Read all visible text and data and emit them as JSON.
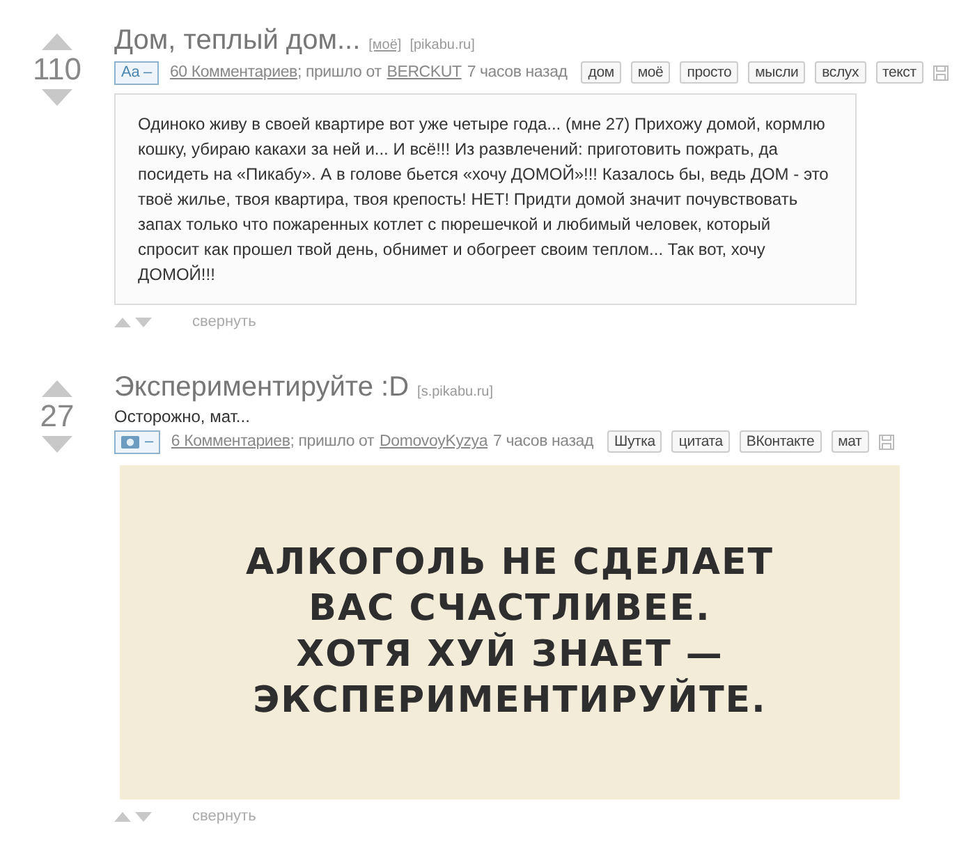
{
  "posts": [
    {
      "kind": "text",
      "score": "110",
      "title": "Дом, теплый дом...",
      "sources": [
        "[моё]",
        "[pikabu.ru]"
      ],
      "badge": {
        "kind": "text",
        "label": "Аа –"
      },
      "comments": "60 Комментариев",
      "via": "; пришло от",
      "author": "BERCKUT",
      "time": "7 часов назад",
      "tags": [
        "дом",
        "моё",
        "просто",
        "мысли",
        "вслух",
        "текст"
      ],
      "body": "Одиноко живу в своей квартире вот уже четыре года... (мне 27) Прихожу домой, кормлю кошку, убираю какахи за ней и... И всё!!! Из развлечений: приготовить пожрать, да посидеть на «Пикабу». А в голове бьется «хочу ДОМОЙ»!!! Казалось бы, ведь ДОМ - это твоё жилье, твоя квартира, твоя крепость! НЕТ! Придти домой значит почувствовать запах только что пожаренных котлет с пюрешечкой и любимый человек, который спросит как прошел твой день, обнимет и обогреет своим теплом... Так вот, хочу ДОМОЙ!!!",
      "collapse": "свернуть"
    },
    {
      "kind": "image",
      "score": "27",
      "title": "Экспериментируйте :D",
      "subtitle": "Осторожно, мат...",
      "sources": [
        "[s.pikabu.ru]"
      ],
      "badge": {
        "kind": "photo",
        "label": "–"
      },
      "comments": "6 Комментариев",
      "via": "; пришло от",
      "author": "DomovoyKyzya",
      "time": "7 часов назад",
      "tags": [
        "Шутка",
        "цитата",
        "ВКонтакте",
        "мат"
      ],
      "image_lines": [
        "АЛКОГОЛЬ НЕ СДЕЛАЕТ",
        "ВАС СЧАСТЛИВЕЕ.",
        "ХОТЯ ХУЙ ЗНАЕТ —",
        "ЭКСПЕРИМЕНТИРУЙТЕ."
      ],
      "collapse": "свернуть"
    }
  ]
}
